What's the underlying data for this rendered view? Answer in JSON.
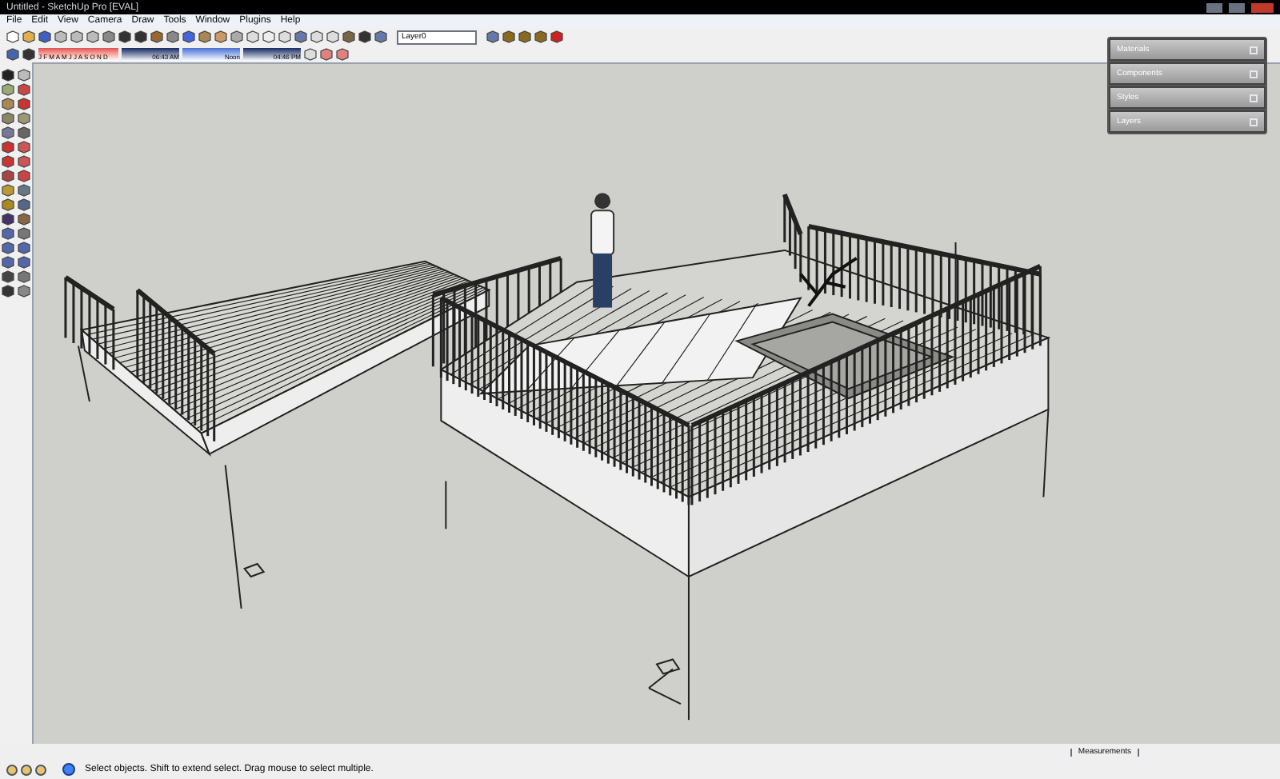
{
  "window": {
    "title": "Untitled - SketchUp Pro [EVAL]"
  },
  "menu": [
    "File",
    "Edit",
    "View",
    "Camera",
    "Draw",
    "Tools",
    "Window",
    "Plugins",
    "Help"
  ],
  "layer_dropdown": {
    "value": "Layer0"
  },
  "shadow_settings": {
    "months": "J F M A M J J A S O N D",
    "start_time": "06:43 AM",
    "noon": "Noon",
    "end_time": "04:46 PM"
  },
  "panels": [
    {
      "title": "Materials"
    },
    {
      "title": "Components"
    },
    {
      "title": "Styles"
    },
    {
      "title": "Layers"
    }
  ],
  "measurements": {
    "label": "Measurements"
  },
  "status_bar": {
    "text": "Select objects. Shift to extend select. Drag mouse to select multiple."
  }
}
